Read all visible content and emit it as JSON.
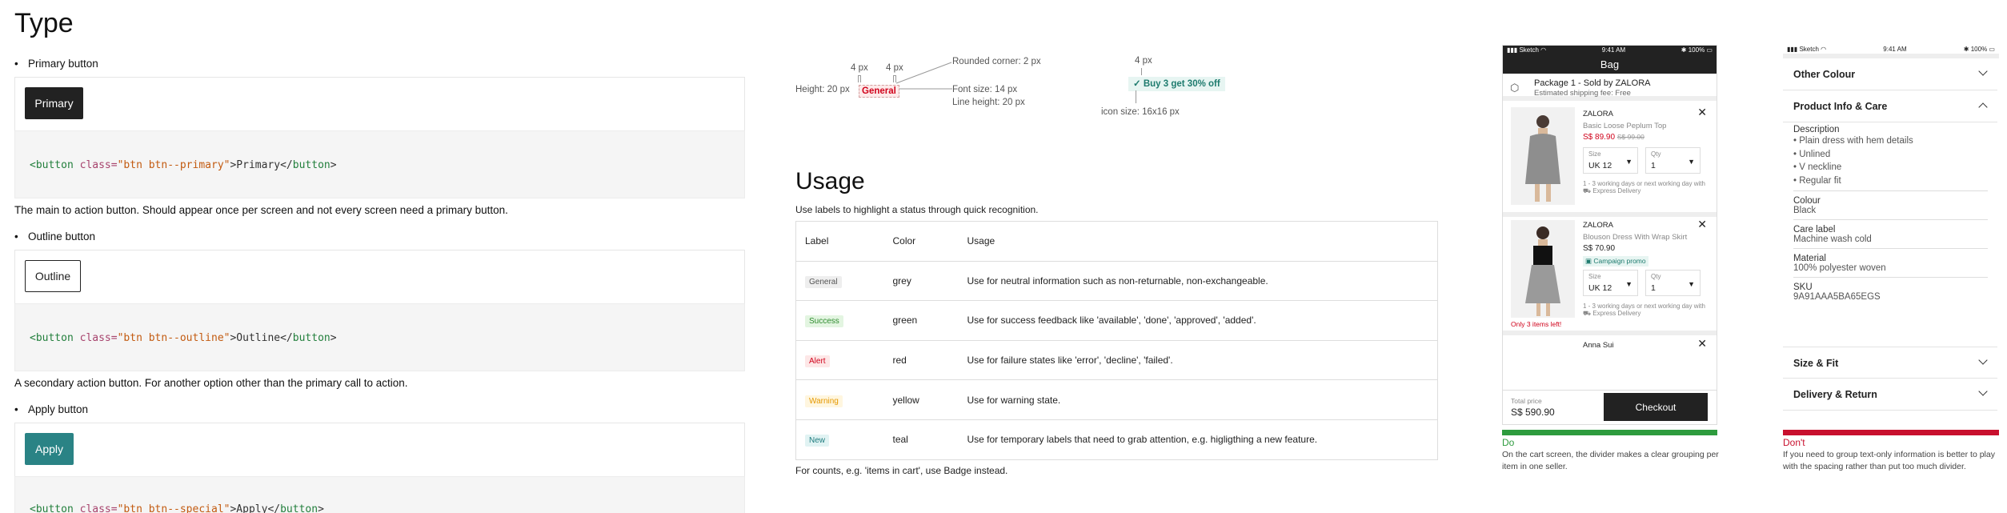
{
  "type_section": {
    "title": "Type",
    "primary": {
      "bullet": "Primary button",
      "button_label": "Primary",
      "code": {
        "open_tag": "<button",
        "class_attr": "class=",
        "class_val": "\"btn btn--primary\"",
        "content": ">Primary</",
        "close_tag": "button",
        "end": ">"
      },
      "description": "The main to action button. Should appear once per screen and not every screen need a primary button."
    },
    "outline": {
      "bullet": "Outline button",
      "button_label": "Outline",
      "code": {
        "open_tag": "<button",
        "class_attr": "class=",
        "class_val": "\"btn btn--outline\"",
        "content": ">Outline</",
        "close_tag": "button",
        "end": ">"
      },
      "description": "A secondary action button. For another option other than the primary call to action."
    },
    "apply": {
      "bullet": "Apply button",
      "button_label": "Apply",
      "code": {
        "open_tag": "<button",
        "class_attr": "class=",
        "class_val": "\"btn btn--special\"",
        "content": ">Apply</",
        "close_tag": "button",
        "end": ">"
      }
    }
  },
  "anatomy": {
    "padding_left": "4 px",
    "padding_right": "4 px",
    "rounded_corner": "Rounded corner: 2 px",
    "height": "Height: 20 px",
    "tag_label": "General",
    "font_size": "Font size: 14 px",
    "line_height": "Line height: 20 px",
    "icon_padding": "4 px",
    "promo_label": "Buy 3 get 30% off",
    "icon_size": "icon size: 16x16 px"
  },
  "usage_section": {
    "title": "Usage",
    "intro": "Use labels to highlight a status through quick recognition.",
    "headers": [
      "Label",
      "Color",
      "Usage"
    ],
    "rows": [
      {
        "label": "General",
        "color": "grey",
        "usage": "Use for neutral information such as non-returnable, non-exchangeable.",
        "bg": "#eeeeee",
        "fg": "#555555"
      },
      {
        "label": "Success",
        "color": "green",
        "usage": "Use for success feedback like 'available', 'done', 'approved', 'added'.",
        "bg": "#e3f5e1",
        "fg": "#2e8b2e"
      },
      {
        "label": "Alert",
        "color": "red",
        "usage": "Use for failure states like 'error', 'decline', 'failed'.",
        "bg": "#fde7e7",
        "fg": "#d0021b"
      },
      {
        "label": "Warning",
        "color": "yellow",
        "usage": "Use for warning state.",
        "bg": "#fff6df",
        "fg": "#e59800"
      },
      {
        "label": "New",
        "color": "teal",
        "usage": "Use for temporary labels that need to grab attention, e.g. higligthing a new feature.",
        "bg": "#e1f3f3",
        "fg": "#1e7b7e"
      }
    ],
    "footnote": "For counts, e.g. 'items in cart', use Badge instead."
  },
  "phone_do": {
    "status": {
      "carrier": "Sketch",
      "time": "9:41 AM",
      "battery": "100%"
    },
    "title": "Bag",
    "package_title": "Package 1 - Sold by ZALORA",
    "shipping": "Estimated shipping fee: Free",
    "items": [
      {
        "brand": "ZALORA",
        "name": "Basic Loose Peplum Top",
        "price": "S$ 89.90",
        "old_price": "S$ 99.00",
        "size_label": "Size",
        "size": "UK 12",
        "qty_label": "Qty",
        "qty": "1",
        "delivery": "1 - 3 working days or next working day with",
        "express": "Express Delivery"
      },
      {
        "brand": "ZALORA",
        "name": "Blouson Dress With Wrap Skirt",
        "price": "S$ 70.90",
        "promo": "Campaign promo",
        "size_label": "Size",
        "size": "UK 12",
        "qty_label": "Qty",
        "qty": "1",
        "delivery": "1 - 3 working days or next working day with",
        "express": "Express Delivery",
        "stock": "Only 3 items left!"
      }
    ],
    "next_brand": "Anna Sui",
    "total_label": "Total price",
    "total": "S$ 590.90",
    "checkout": "Checkout",
    "verdict": "Do",
    "verdict_color": "#2e9b3e",
    "caption": "On the cart screen, the divider makes a clear grouping per item in one seller."
  },
  "phone_dont": {
    "status": {
      "carrier": "Sketch",
      "time": "9:41 AM",
      "battery": "100%"
    },
    "other_colour": "Other Colour",
    "product_info": "Product Info & Care",
    "description_label": "Description",
    "description_items": [
      "• Plain dress with hem details",
      "• Unlined",
      "• V neckline",
      "• Regular fit"
    ],
    "colour_label": "Colour",
    "colour": "Black",
    "care_label": "Care label",
    "care": "Machine wash cold",
    "material_label": "Material",
    "material": "100% polyester woven",
    "sku_label": "SKU",
    "sku": "9A91AAA5BA65EGS",
    "size_fit": "Size & Fit",
    "delivery_return": "Delivery & Return",
    "verdict": "Don't",
    "verdict_color": "#c8102e",
    "caption": "If you need to group text-only information is better to play with the spacing rather than put too much divider."
  }
}
